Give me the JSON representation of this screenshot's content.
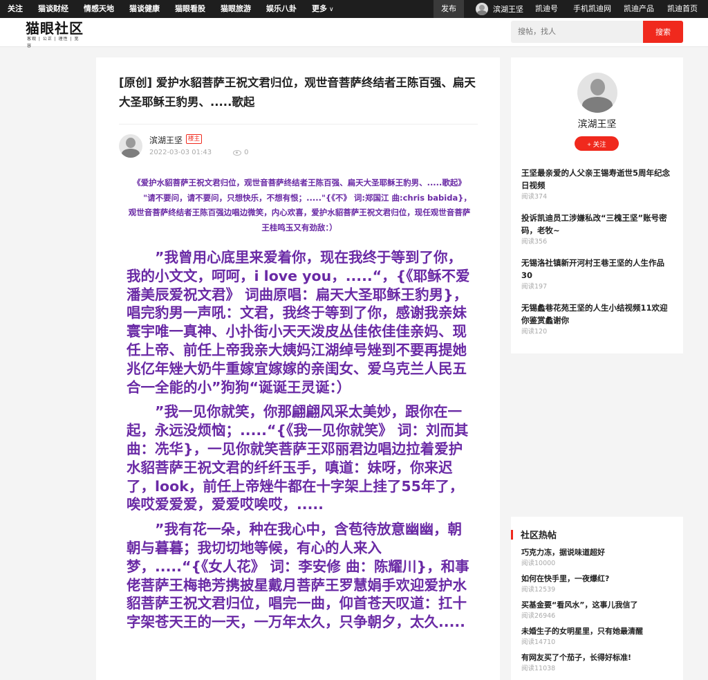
{
  "topnav": {
    "left_items": [
      "关注",
      "猫谈财经",
      "情感天地",
      "猫谈健康",
      "猫眼看股",
      "猫眼旅游",
      "娱乐八卦",
      "更多"
    ],
    "publish": "发布",
    "username": "滨湖王坚",
    "right_items": [
      "凯迪号",
      "手机凯迪网",
      "凯迪产品",
      "凯迪首页"
    ]
  },
  "header": {
    "logo_main": "猫眼社区",
    "logo_sub": "客观 | 公正 | 理性 | 宽容",
    "search_placeholder": "搜帖，找人",
    "search_button": "搜索"
  },
  "article": {
    "title": "[原创] 爱护水貂菩萨王祝文君归位，观世音菩萨终结者王陈百强、扁天大圣耶稣王豹男、.....歌起",
    "author": "滨湖王坚",
    "author_badge": "楼主",
    "date": "2022-03-03 01:43",
    "views": "0",
    "intro_line1": "《爱护水貂菩萨王祝文君归位，观世音菩萨终结者王陈百强、扁天大圣耶稣王豹男、.....歌起》",
    "intro_line2": "\"请不要问，请不要问，只想快乐，不想有恨；.....\"{《不》 词:郑国江 曲:chris babida}，观世音菩萨终结者王陈百强边唱边微笑，内心欢喜，爱护水貂菩萨王祝文君归位，现任观世音菩萨王桂鸣玉又有劲敌：）",
    "paragraphs": [
      "”我曾用心底里来爱着你，现在我终于等到了你，我的小文文，呵呵，i love you，.....“，{《耶稣不爱潘美辰爱祝文君》 词曲原唱：扁天大圣耶稣王豹男}，唱完豹男一声吼：文君，我终于等到了你，感谢我亲妹寰宇唯一真神、小扑街小天天泼皮丛佳依佳佳亲妈、现任上帝、前任上帝我亲大姨妈江湖绰号矬到不要再提她兆亿年矬大奶牛重嫁宜嫁嫁的亲闺女、爱乌克兰人民五合一全能的小”狗狗“诞诞王灵诞：）",
      "”我一见你就笑，你那翩翩风采太美妙，跟你在一起，永远没烦恼；.....“{《我一见你就笑》 词：刘而其 曲：冼华}，一见你就笑菩萨王邓丽君边唱边拉着爱护水貂菩萨王祝文君的纤纤玉手，嗔道：妹呀，你来迟了，look，前任上帝矬牛都在十字架上挂了55年了，唉哎爱爱爱，爱爱哎唉哎，.....",
      "”我有花一朵，种在我心中，含苞待放意幽幽，朝朝与暮暮；我切切地等候，有心的人来入梦，.....“{《女人花》 词：李安修 曲：陈耀川}，和事佬菩萨王梅艳芳携披星戴月菩萨王罗慧娟手欢迎爱护水貂菩萨王祝文君归位，唱完一曲，仰首苍天叹道：扛十字架苍天王的一天，一万年太久，只争朝夕，太久....."
    ]
  },
  "profile": {
    "name": "滨湖王坚",
    "follow": "+ 关注",
    "posts": [
      {
        "title": "王坚最亲爱的人父亲王锡寿逝世5周年纪念日视频",
        "reads": "阅读374"
      },
      {
        "title": "投诉凯迪员工涉嫌私改“三槐王坚”账号密码，老牧~",
        "reads": "阅读356"
      },
      {
        "title": "无锡洛社镇新开河村王巷王坚的人生作品30",
        "reads": "阅读197"
      },
      {
        "title": "无锡蠡巷花苑王坚的人生小结视频11欢迎你鉴赏蠡谢你",
        "reads": "阅读120"
      }
    ]
  },
  "hot": {
    "heading": "社区热帖",
    "items": [
      {
        "title": "巧克力冻，据说味道超好",
        "reads": "阅读10000"
      },
      {
        "title": "如何在快手里，一夜爆红?",
        "reads": "阅读12539"
      },
      {
        "title": "买基金要“看风水”，这事儿我信了",
        "reads": "阅读26946"
      },
      {
        "title": "未婚生子的女明星里，只有她最清醒",
        "reads": "阅读14710"
      },
      {
        "title": "有网友买了个茄子，长得好标准!",
        "reads": "阅读11038"
      }
    ]
  }
}
